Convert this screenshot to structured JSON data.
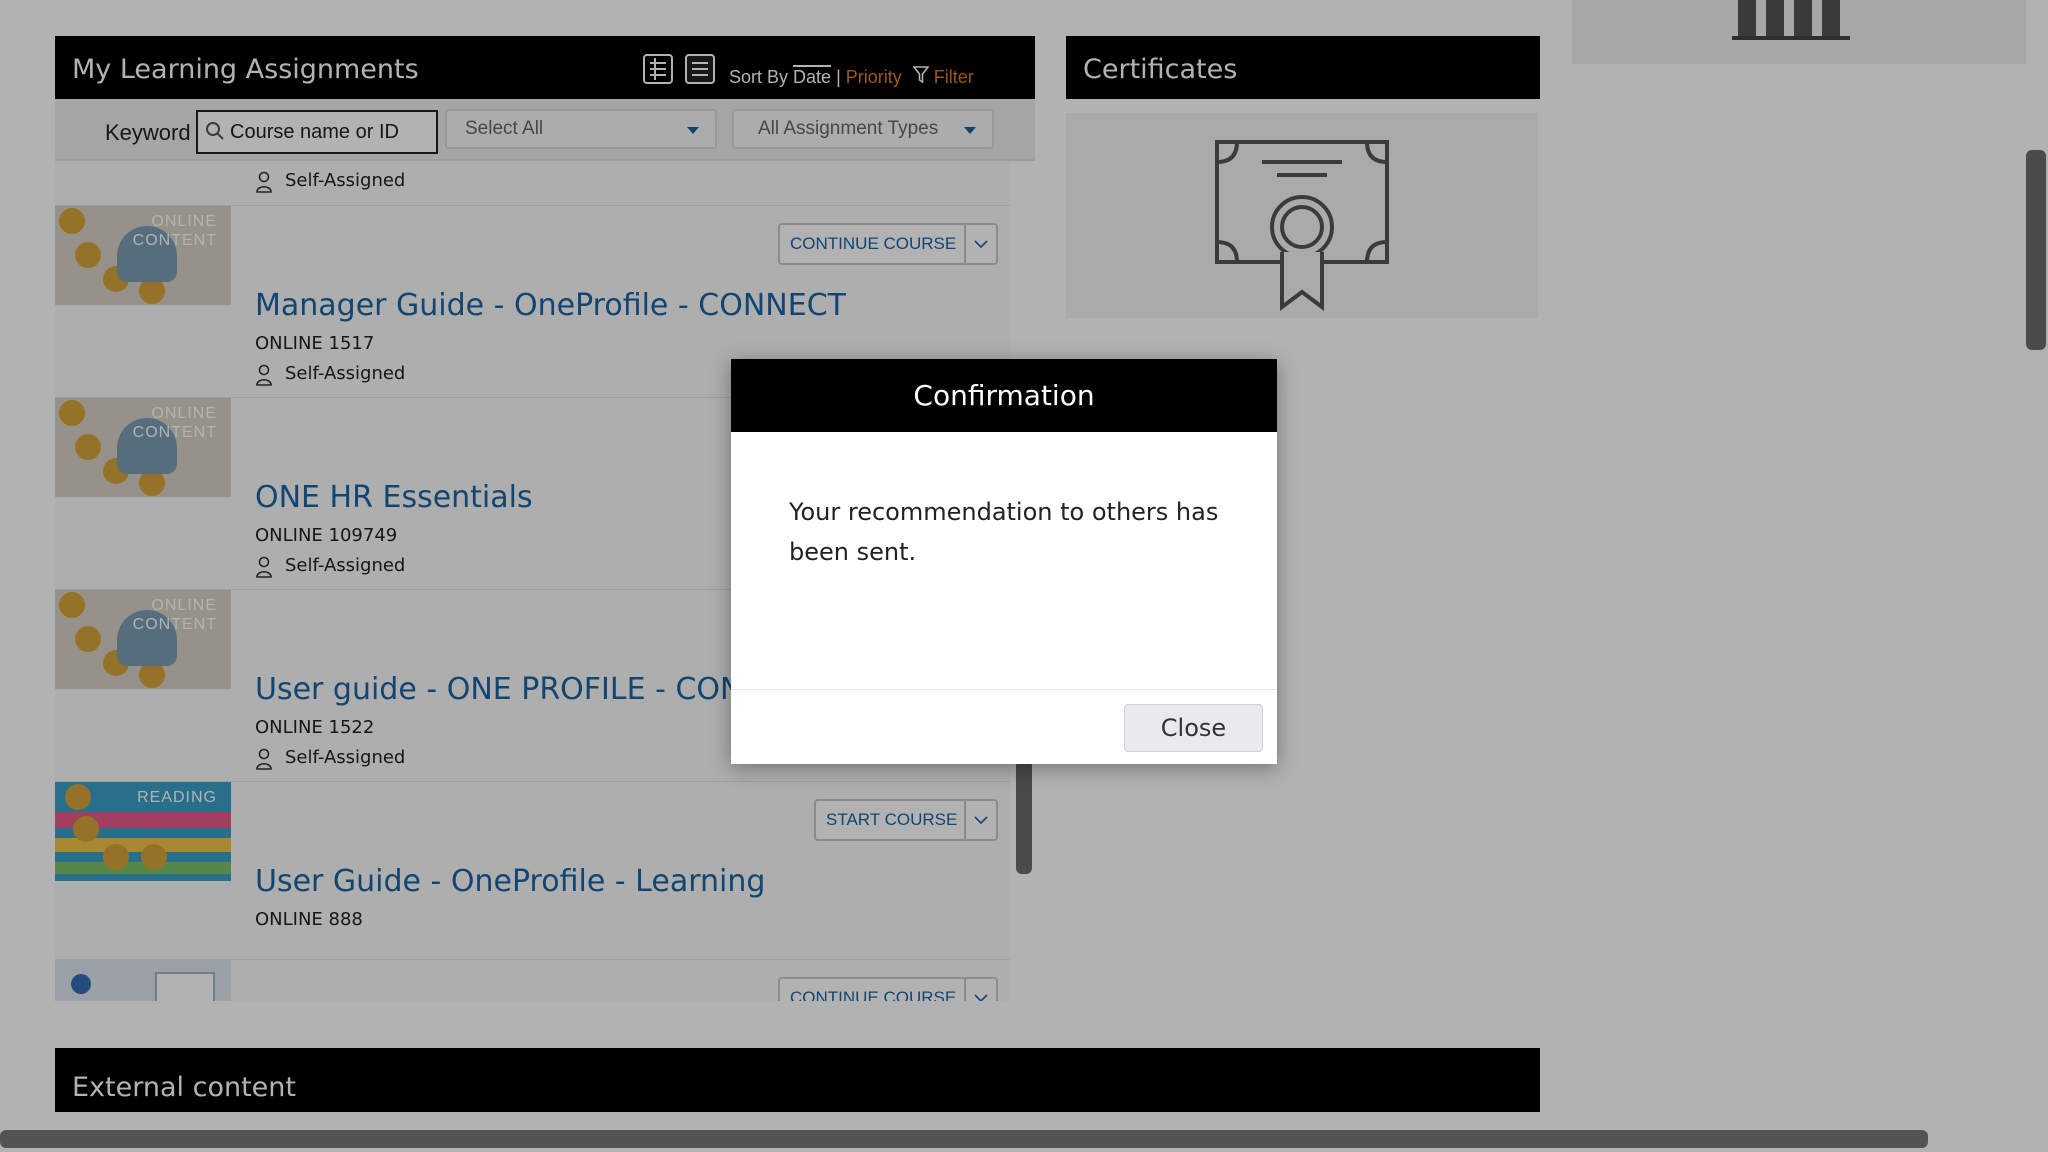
{
  "learning": {
    "title": "My Learning Assignments",
    "sort_prefix": "Sort By ",
    "sort_date": "Date",
    "sort_sep": " | ",
    "sort_priority": "Priority",
    "filter_label": "Filter",
    "keyword_label": "Keyword",
    "keyword_placeholder": "Course name or ID",
    "select_all": "Select All",
    "assignment_types": "All Assignment Types",
    "top_assigned": "Self-Assigned",
    "items": [
      {
        "title": "Manager Guide - OneProfile - CONNECT",
        "id": "ONLINE 1517",
        "assigned": "Self-Assigned",
        "thumb_tag_line1": "ONLINE",
        "thumb_tag_line2": "CONTENT",
        "button": "CONTINUE COURSE"
      },
      {
        "title": "ONE HR Essentials",
        "id": "ONLINE 109749",
        "assigned": "Self-Assigned",
        "thumb_tag_line1": "ONLINE",
        "thumb_tag_line2": "CONTENT",
        "button": ""
      },
      {
        "title": "User guide - ONE PROFILE - CON",
        "id": "ONLINE 1522",
        "assigned": "Self-Assigned",
        "thumb_tag_line1": "ONLINE",
        "thumb_tag_line2": "CONTENT",
        "button": ""
      },
      {
        "title": "User Guide - OneProfile - Learning",
        "id": "ONLINE 888",
        "assigned": "",
        "thumb_tag_line1": "READING",
        "thumb_tag_line2": "",
        "button": "START COURSE"
      },
      {
        "title": "",
        "id": "",
        "assigned": "",
        "thumb_tag_line1": "",
        "thumb_tag_line2": "",
        "button": "CONTINUE COURSE"
      }
    ]
  },
  "certificates": {
    "title": "Certificates"
  },
  "external": {
    "title": "External content"
  },
  "dialog": {
    "title": "Confirmation",
    "message": "Your recommendation to others has been sent.",
    "close_label": "Close"
  },
  "icons": {
    "search": "search-icon",
    "person": "person-icon",
    "filter": "filter-icon",
    "chevron": "chevron-down-icon",
    "certificate": "certificate-icon",
    "list_view": "list-view-icon",
    "grid_view": "detail-view-icon"
  },
  "colors": {
    "link_blue": "#1a64a3",
    "accent_orange": "#e0801f",
    "header_black": "#000000",
    "overlay": "rgba(0,0,0,0.30)"
  }
}
